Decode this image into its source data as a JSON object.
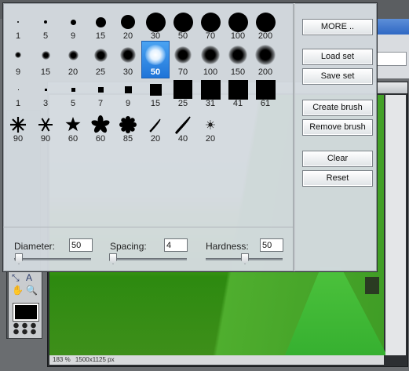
{
  "status_bar": {
    "zoom": "183 %",
    "size": "1500x1125 px"
  },
  "brush_rows": [
    [
      {
        "size": "1",
        "shape": "hard",
        "d": 2
      },
      {
        "size": "5",
        "shape": "hard",
        "d": 4
      },
      {
        "size": "9",
        "shape": "hard",
        "d": 7
      },
      {
        "size": "15",
        "shape": "hard",
        "d": 13
      },
      {
        "size": "20",
        "shape": "hard",
        "d": 18
      },
      {
        "size": "30",
        "shape": "hard",
        "d": 25
      },
      {
        "size": "50",
        "shape": "hard",
        "d": 25
      },
      {
        "size": "70",
        "shape": "hard",
        "d": 25
      },
      {
        "size": "100",
        "shape": "hard",
        "d": 25
      },
      {
        "size": "200",
        "shape": "hard",
        "d": 25
      }
    ],
    [
      {
        "size": "9",
        "shape": "soft",
        "d": 8
      },
      {
        "size": "15",
        "shape": "soft",
        "d": 11
      },
      {
        "size": "20",
        "shape": "soft",
        "d": 13
      },
      {
        "size": "25",
        "shape": "soft",
        "d": 17
      },
      {
        "size": "30",
        "shape": "soft",
        "d": 20
      },
      {
        "size": "50",
        "shape": "glow",
        "d": 26,
        "selected": true
      },
      {
        "size": "70",
        "shape": "soft",
        "d": 22
      },
      {
        "size": "100",
        "shape": "soft",
        "d": 24
      },
      {
        "size": "150",
        "shape": "soft",
        "d": 24
      },
      {
        "size": "200",
        "shape": "soft",
        "d": 26
      }
    ],
    [
      {
        "size": "1",
        "shape": "sq",
        "d": 1
      },
      {
        "size": "3",
        "shape": "sq",
        "d": 3
      },
      {
        "size": "5",
        "shape": "sq",
        "d": 5
      },
      {
        "size": "7",
        "shape": "sq",
        "d": 7
      },
      {
        "size": "9",
        "shape": "sq",
        "d": 9
      },
      {
        "size": "15",
        "shape": "sq",
        "d": 15
      },
      {
        "size": "25",
        "shape": "sq",
        "d": 24
      },
      {
        "size": "31",
        "shape": "sq",
        "d": 25
      },
      {
        "size": "41",
        "shape": "sq",
        "d": 25
      },
      {
        "size": "61",
        "shape": "sq",
        "d": 25
      }
    ],
    [
      {
        "size": "90",
        "shape": "star8"
      },
      {
        "size": "90",
        "shape": "star6"
      },
      {
        "size": "60",
        "shape": "star5"
      },
      {
        "size": "60",
        "shape": "flower"
      },
      {
        "size": "85",
        "shape": "gear"
      },
      {
        "size": "20",
        "shape": "slash"
      },
      {
        "size": "40",
        "shape": "slash2"
      },
      {
        "size": "20",
        "shape": "spark"
      }
    ]
  ],
  "buttons": {
    "more": "MORE ..",
    "load_set": "Load set",
    "save_set": "Save set",
    "create_brush": "Create brush",
    "remove_brush": "Remove brush",
    "clear": "Clear",
    "reset": "Reset"
  },
  "controls": {
    "diameter": {
      "label": "Diameter:",
      "value": "50"
    },
    "spacing": {
      "label": "Spacing:",
      "value": "4"
    },
    "hardness": {
      "label": "Hardness:",
      "value": "50"
    }
  }
}
